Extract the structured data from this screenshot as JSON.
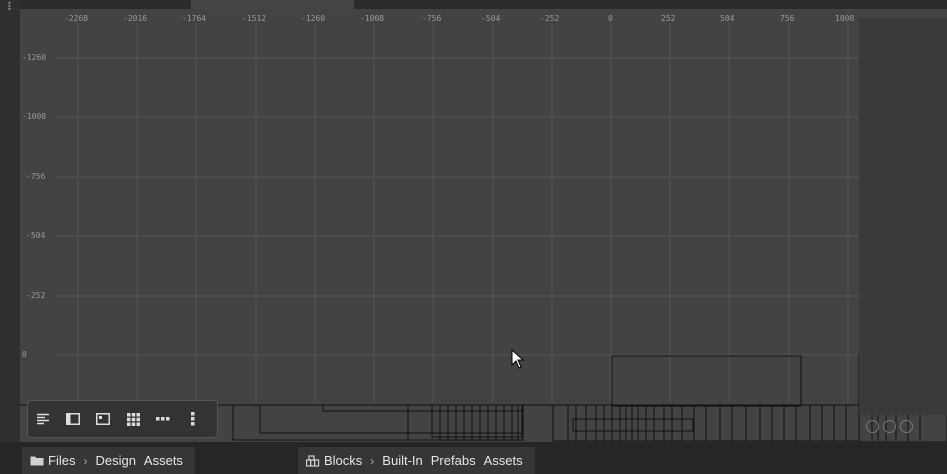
{
  "ruler": {
    "x_ticks": [
      "-2268",
      "-2016",
      "-1764",
      "-1512",
      "-1260",
      "-1008",
      "-756",
      "-504",
      "-252",
      "0",
      "252",
      "504",
      "756",
      "1008"
    ],
    "y_ticks": [
      "-1260",
      "-1008",
      "-756",
      "-504",
      "-252",
      "0"
    ]
  },
  "toolbar": {
    "buttons": [
      {
        "icon": "align-left-icon"
      },
      {
        "icon": "sidebar-panel-icon"
      },
      {
        "icon": "image-panel-icon"
      },
      {
        "icon": "grid-icon"
      },
      {
        "icon": "more-horizontal-icon"
      },
      {
        "icon": "more-vertical-icon"
      }
    ]
  },
  "breadcrumbs_left": {
    "icon": "folder-icon",
    "items": [
      "Files",
      "Design",
      "Assets"
    ]
  },
  "breadcrumbs_right": {
    "icon": "blocks-icon",
    "items": [
      "Blocks",
      "Built-In",
      "Prefabs",
      "Assets"
    ]
  },
  "colors": {
    "canvas": "#434343",
    "gridline": "#5a5a5a",
    "shape": "#111111"
  }
}
